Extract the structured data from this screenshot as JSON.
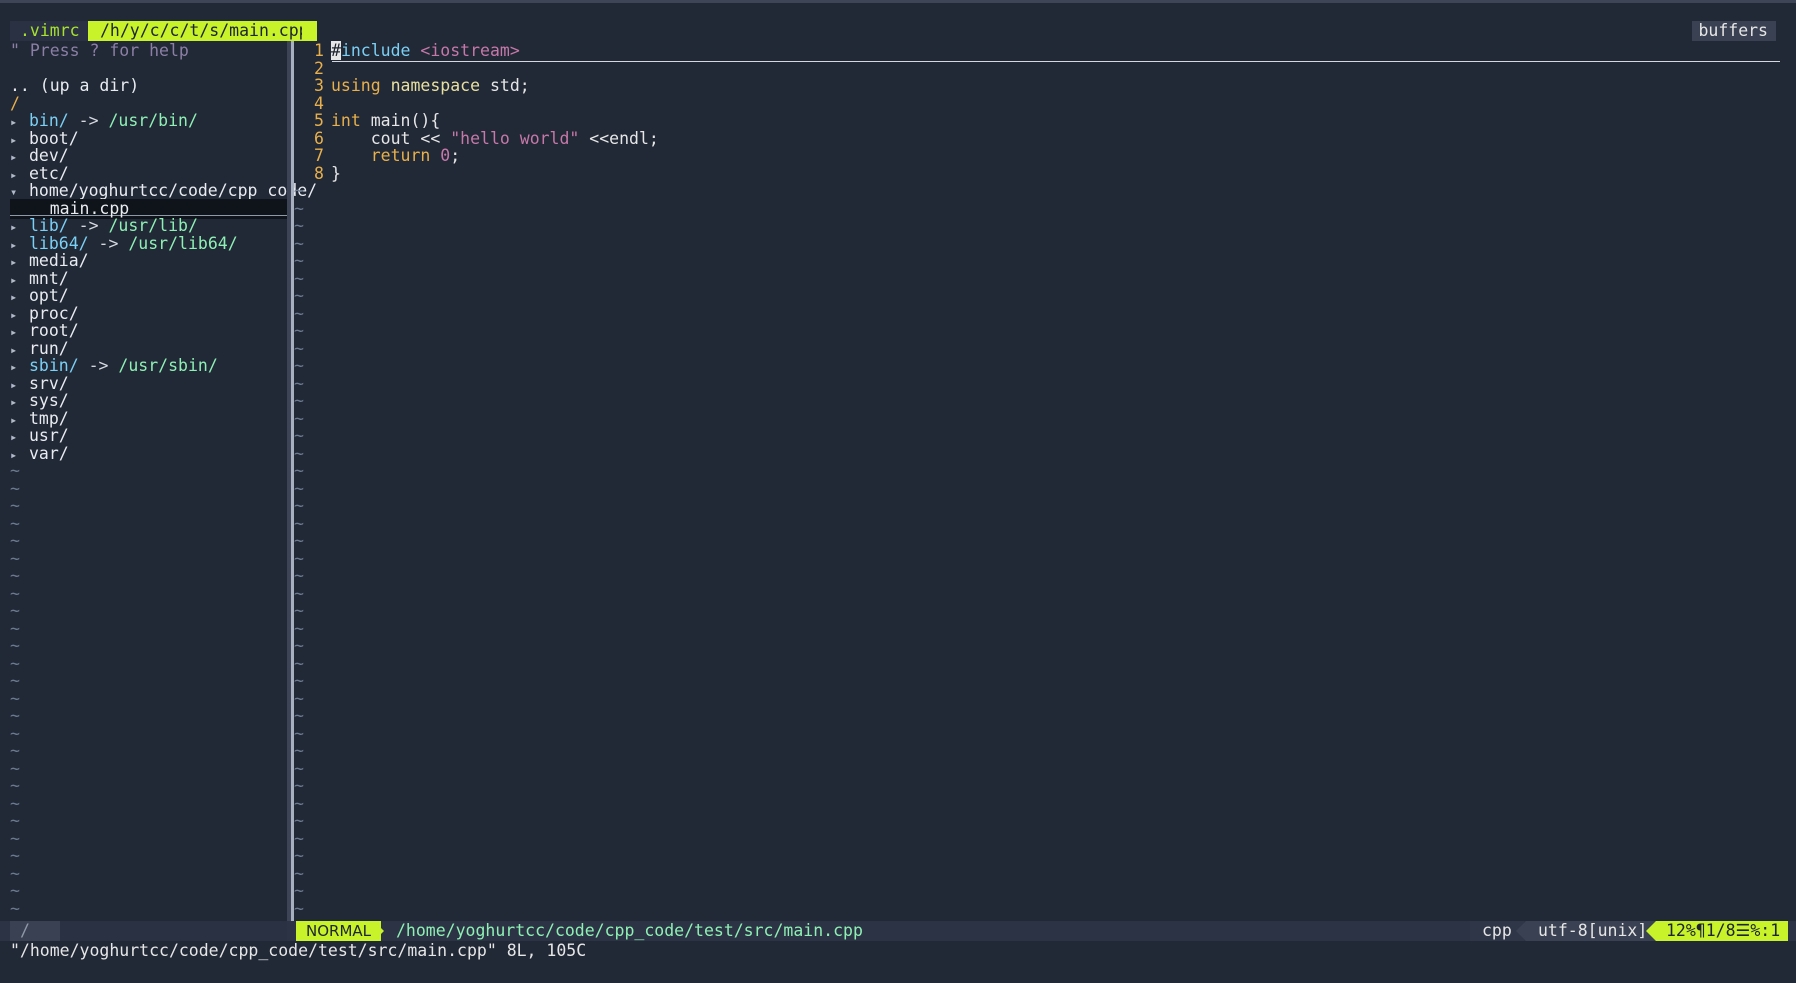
{
  "tabline": {
    "tab1": ".vimrc",
    "tab2": "/h/y/c/c/t/s/main.cpp",
    "buffers": "buffers"
  },
  "tree": {
    "help": "\" Press ? for help",
    "updir": ".. (up a dir)",
    "root": "/",
    "items": [
      {
        "kind": "link",
        "name": "bin/",
        "arrow": " -> ",
        "target": "/usr/bin/"
      },
      {
        "kind": "dir",
        "name": "boot/"
      },
      {
        "kind": "dir",
        "name": "dev/"
      },
      {
        "kind": "dir",
        "name": "etc/"
      },
      {
        "kind": "open",
        "name": "home/yoghurtcc/code/cpp_code/"
      },
      {
        "kind": "file",
        "name": "main.cpp"
      },
      {
        "kind": "link",
        "name": "lib/",
        "arrow": " -> ",
        "target": "/usr/lib/"
      },
      {
        "kind": "link",
        "name": "lib64/",
        "arrow": " -> ",
        "target": "/usr/lib64/"
      },
      {
        "kind": "dir",
        "name": "media/"
      },
      {
        "kind": "dir",
        "name": "mnt/"
      },
      {
        "kind": "dir",
        "name": "opt/"
      },
      {
        "kind": "dir",
        "name": "proc/"
      },
      {
        "kind": "dir",
        "name": "root/"
      },
      {
        "kind": "dir",
        "name": "run/"
      },
      {
        "kind": "link",
        "name": "sbin/",
        "arrow": " -> ",
        "target": "/usr/sbin/"
      },
      {
        "kind": "dir",
        "name": "srv/"
      },
      {
        "kind": "dir",
        "name": "sys/"
      },
      {
        "kind": "dir",
        "name": "tmp/"
      },
      {
        "kind": "dir",
        "name": "usr/"
      },
      {
        "kind": "dir",
        "name": "var/"
      }
    ]
  },
  "editor": {
    "line_numbers": [
      "1",
      "2",
      "3",
      "4",
      "5",
      "6",
      "7",
      "8"
    ],
    "lines": [
      [
        {
          "t": "#",
          "c": "cursor"
        },
        {
          "t": "include ",
          "c": "prep"
        },
        {
          "t": "<iostream>",
          "c": "incl"
        }
      ],
      [],
      [
        {
          "t": "using ",
          "c": "kw"
        },
        {
          "t": "namespace ",
          "c": "ns"
        },
        {
          "t": "std;",
          "c": "plain"
        }
      ],
      [],
      [
        {
          "t": "int ",
          "c": "kw"
        },
        {
          "t": "main(){",
          "c": "plain"
        }
      ],
      [
        {
          "t": "    cout << ",
          "c": "plain"
        },
        {
          "t": "\"hello world\"",
          "c": "str"
        },
        {
          "t": " <<endl;",
          "c": "plain"
        }
      ],
      [
        {
          "t": "    ",
          "c": "plain"
        },
        {
          "t": "return ",
          "c": "kw"
        },
        {
          "t": "0",
          "c": "num"
        },
        {
          "t": ";",
          "c": "plain"
        }
      ],
      [
        {
          "t": "}",
          "c": "plain"
        }
      ]
    ],
    "tilde": "~"
  },
  "status": {
    "left": "/",
    "mode": "NORMAL",
    "path": "/home/yoghurtcc/code/cpp_code/test/src/main.cpp",
    "filetype": "cpp",
    "encoding": "utf-8[unix]",
    "position": "12%¶1/8☰%:1"
  },
  "cmdline": "\"/home/yoghurtcc/code/cpp_code/test/src/main.cpp\" 8L, 105C",
  "colors": {
    "background": "#212836",
    "accent": "#c8f229",
    "line_number": "#e8b04c",
    "link": "#7bd0f5",
    "link_target": "#8ef0b4",
    "string": "#c678a8"
  },
  "icons": {
    "closed_dir": "triangle-right-icon",
    "open_dir": "triangle-down-icon"
  }
}
